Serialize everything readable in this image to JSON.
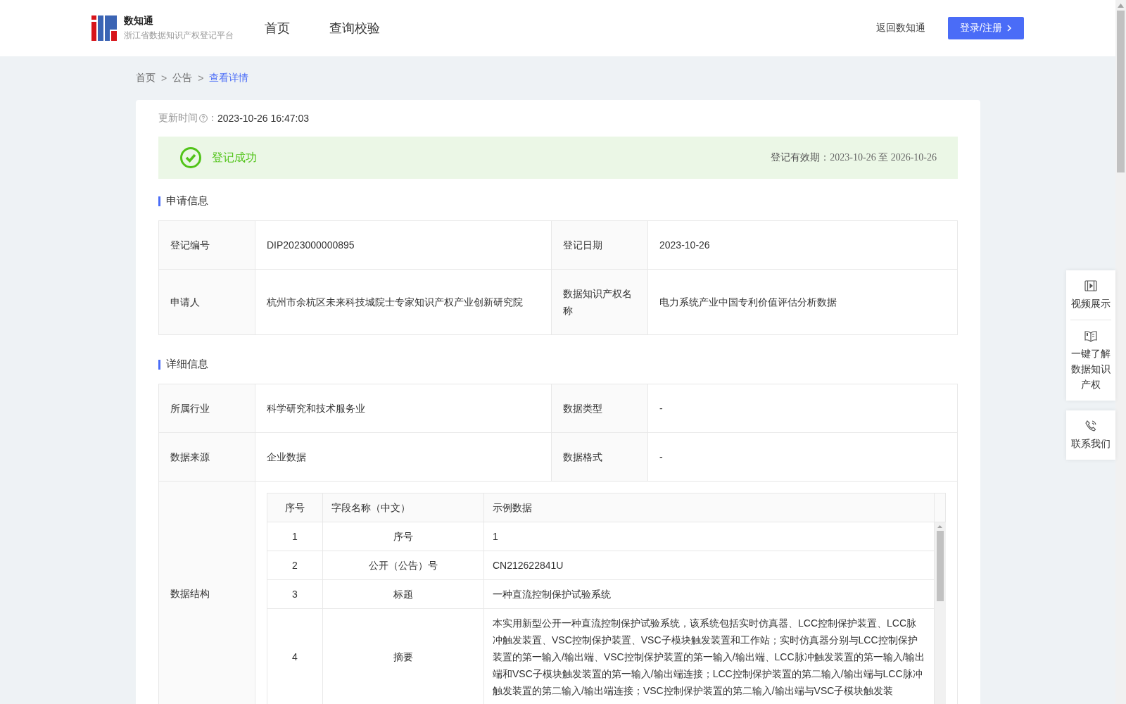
{
  "header": {
    "logo_title": "数知通",
    "logo_subtitle": "浙江省数据知识产权登记平台",
    "nav": [
      {
        "label": "首页",
        "selected": false
      },
      {
        "label": "查询校验",
        "selected": false
      }
    ],
    "back_link": "返回数知通",
    "login_button": "登录/注册"
  },
  "breadcrumb": {
    "items": [
      "首页",
      "公告"
    ],
    "separator": ">",
    "current": "查看详情"
  },
  "update_time": {
    "label": "更新时间",
    "colon": "：",
    "value": "2023-10-26 16:47:03"
  },
  "status": {
    "text": "登记成功",
    "validity_label": "登记有效期：",
    "validity_value": "2023-10-26 至 2026-10-26"
  },
  "application_info": {
    "title": "申请信息",
    "rows": [
      [
        {
          "label": "登记编号",
          "value": "DIP2023000000895"
        },
        {
          "label": "登记日期",
          "value": "2023-10-26"
        }
      ],
      [
        {
          "label": "申请人",
          "value": "杭州市余杭区未来科技城院士专家知识产权产业创新研究院"
        },
        {
          "label": "数据知识产权名称",
          "value": "电力系统产业中国专利价值评估分析数据"
        }
      ]
    ]
  },
  "detail_info": {
    "title": "详细信息",
    "rows": [
      [
        {
          "label": "所属行业",
          "value": "科学研究和技术服务业"
        },
        {
          "label": "数据类型",
          "value": "-"
        }
      ],
      [
        {
          "label": "数据来源",
          "value": "企业数据"
        },
        {
          "label": "数据格式",
          "value": "-"
        }
      ]
    ],
    "structure": {
      "label": "数据结构",
      "columns": [
        "序号",
        "字段名称（中文）",
        "示例数据"
      ],
      "rows": [
        [
          "1",
          "序号",
          "1"
        ],
        [
          "2",
          "公开（公告）号",
          "CN212622841U"
        ],
        [
          "3",
          "标题",
          "一种直流控制保护试验系统"
        ],
        [
          "4",
          "摘要",
          "本实用新型公开一种直流控制保护试验系统，该系统包括实时仿真器、LCC控制保护装置、LCC脉冲触发装置、VSC控制保护装置、VSC子模块触发装置和工作站；实时仿真器分别与LCC控制保护装置的第一输入/输出端、VSC控制保护装置的第一输入/输出端、LCC脉冲触发装置的第一输入/输出端和VSC子模块触发装置的第一输入/输出端连接；LCC控制保护装置的第二输入/输出端与LCC脉冲触发装置的第二输入/输出端连接；VSC控制保护装置的第二输入/输出端与VSC子模块触发装"
        ]
      ]
    }
  },
  "side_panel": [
    {
      "kind": "video",
      "label": "视频展示"
    },
    {
      "kind": "book",
      "label": "一键了解数据知识产权"
    },
    {
      "kind": "phone",
      "label": "联系我们"
    }
  ]
}
